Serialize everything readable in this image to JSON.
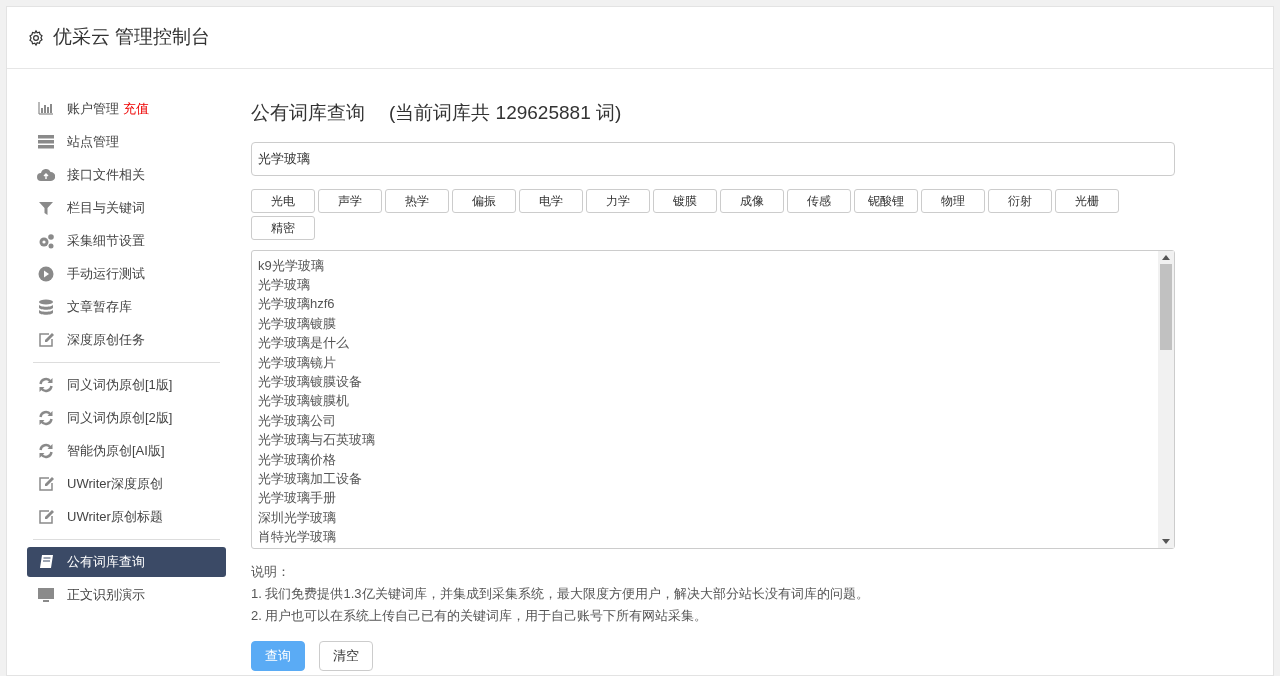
{
  "header": {
    "title": "优采云 管理控制台"
  },
  "sidebar": {
    "groups": [
      {
        "items": [
          {
            "label": "账户管理",
            "badge": "充值",
            "selected": false
          },
          {
            "label": "站点管理",
            "selected": false
          },
          {
            "label": "接口文件相关",
            "selected": false
          },
          {
            "label": "栏目与关键词",
            "selected": false
          },
          {
            "label": "采集细节设置",
            "selected": false
          },
          {
            "label": "手动运行测试",
            "selected": false
          },
          {
            "label": "文章暂存库",
            "selected": false
          },
          {
            "label": "深度原创任务",
            "selected": false
          }
        ]
      },
      {
        "items": [
          {
            "label": "同义词伪原创[1版]",
            "selected": false
          },
          {
            "label": "同义词伪原创[2版]",
            "selected": false
          },
          {
            "label": "智能伪原创[AI版]",
            "selected": false
          },
          {
            "label": "UWriter深度原创",
            "selected": false
          },
          {
            "label": "UWriter原创标题",
            "selected": false
          }
        ]
      },
      {
        "items": [
          {
            "label": "公有词库查询",
            "selected": true
          },
          {
            "label": "正文识别演示",
            "selected": false
          }
        ]
      }
    ]
  },
  "main": {
    "title": "公有词库查询",
    "count_text": "(当前词库共 129625881 词)",
    "search": {
      "value": "光学玻璃"
    },
    "tags": [
      "光电",
      "声学",
      "热学",
      "偏振",
      "电学",
      "力学",
      "镀膜",
      "成像",
      "传感",
      "铌酸锂",
      "物理",
      "衍射",
      "光栅",
      "精密"
    ],
    "results": [
      "k9光学玻璃",
      "光学玻璃",
      "光学玻璃hzf6",
      "光学玻璃镀膜",
      "光学玻璃是什么",
      "光学玻璃镜片",
      "光学玻璃镀膜设备",
      "光学玻璃镀膜机",
      "光学玻璃公司",
      "光学玻璃与石英玻璃",
      "光学玻璃价格",
      "光学玻璃加工设备",
      "光学玻璃手册",
      "深圳光学玻璃",
      "肖特光学玻璃"
    ],
    "notes_title": "说明：",
    "notes": [
      "1. 我们免费提供1.3亿关键词库，并集成到采集系统，最大限度方便用户，解决大部分站长没有词库的问题。",
      "2. 用户也可以在系统上传自己已有的关键词库，用于自己账号下所有网站采集。"
    ],
    "buttons": [
      {
        "label": "查询",
        "kind": "primary"
      },
      {
        "label": "清空",
        "kind": "default"
      }
    ]
  }
}
